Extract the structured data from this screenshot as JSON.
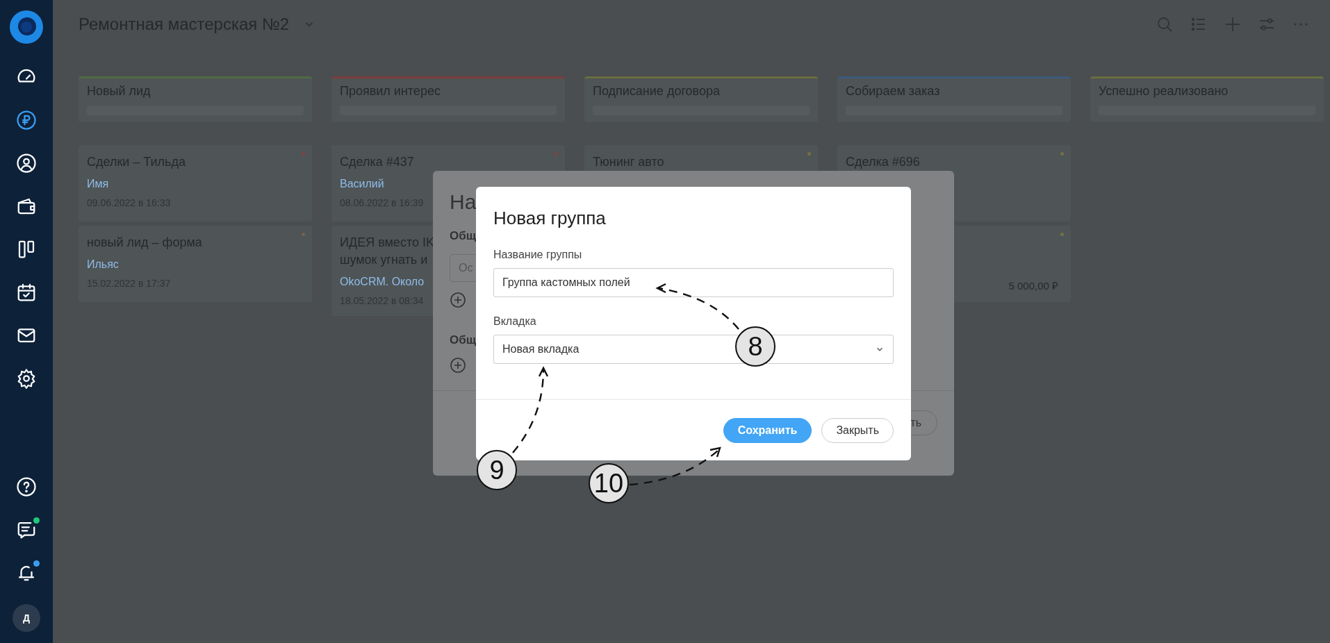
{
  "sidebar": {
    "nav": [
      {
        "kind": "gauge",
        "selected": false
      },
      {
        "kind": "ruble",
        "selected": true
      },
      {
        "kind": "contact",
        "selected": false
      },
      {
        "kind": "wallet",
        "selected": false
      },
      {
        "kind": "board",
        "selected": false
      },
      {
        "kind": "calendar",
        "selected": false
      },
      {
        "kind": "mail",
        "selected": false
      },
      {
        "kind": "settings",
        "selected": false
      }
    ],
    "bottom": [
      {
        "kind": "help"
      },
      {
        "kind": "chat",
        "color": "#22c77a"
      },
      {
        "kind": "bell",
        "color": "#3b9ef0"
      }
    ],
    "avatar": "Д"
  },
  "header": {
    "title": "Ремонтная мастерская №2"
  },
  "board": {
    "columns": [
      {
        "title": "Новый лид",
        "color": "#4e6b45",
        "cards": [
          {
            "title": "Сделки – Тильда",
            "person": "Имя",
            "date": "09.06.2022 в 16:33",
            "color": "#7a4548"
          },
          {
            "title": "новый лид – форма",
            "person": "Ильяс",
            "date": "15.02.2022 в 17:37",
            "color": "#76604a"
          }
        ]
      },
      {
        "title": "Проявил интерес",
        "color": "#7e3c3c",
        "cards": [
          {
            "title": "Сделка #437",
            "person": "Василий",
            "date": "08.06.2022 в 16:39",
            "color": "#7a4548"
          },
          {
            "title": "ИДЕЯ вместо IK\nшумок угнать и",
            "person": "OkoCRM. Около",
            "date": "18.05.2022 в 08:34"
          }
        ]
      },
      {
        "title": "Подписание договора",
        "color": "#6a6e3e",
        "cards": [
          {
            "title": "Тюнинг авто",
            "color": "#747044"
          }
        ]
      },
      {
        "title": "Собираем заказ",
        "color": "#3b5a7d",
        "cards": [
          {
            "title": "Сделка #696",
            "color": "#747044"
          },
          {
            "amount": "5 000,00 ₽",
            "color": "#747044"
          }
        ]
      },
      {
        "title": "Успешно реализовано",
        "color": "#6a6e3e"
      }
    ]
  },
  "background_dialog": {
    "title": "На",
    "section_1": "Общ",
    "field": "Ос",
    "section_2": "Общ",
    "button": "ть"
  },
  "dialog": {
    "title": "Новая группа",
    "name_label": "Название группы",
    "name_value": "Группа кастомных полей",
    "tab_label": "Вкладка",
    "tab_value": "Новая вкладка",
    "buttons": [
      {
        "label": "Сохранить",
        "kind": "primary"
      },
      {
        "label": "Закрыть",
        "kind": "secondary"
      }
    ]
  },
  "callouts": [
    {
      "number": "8"
    },
    {
      "number": "9"
    },
    {
      "number": "10"
    }
  ]
}
